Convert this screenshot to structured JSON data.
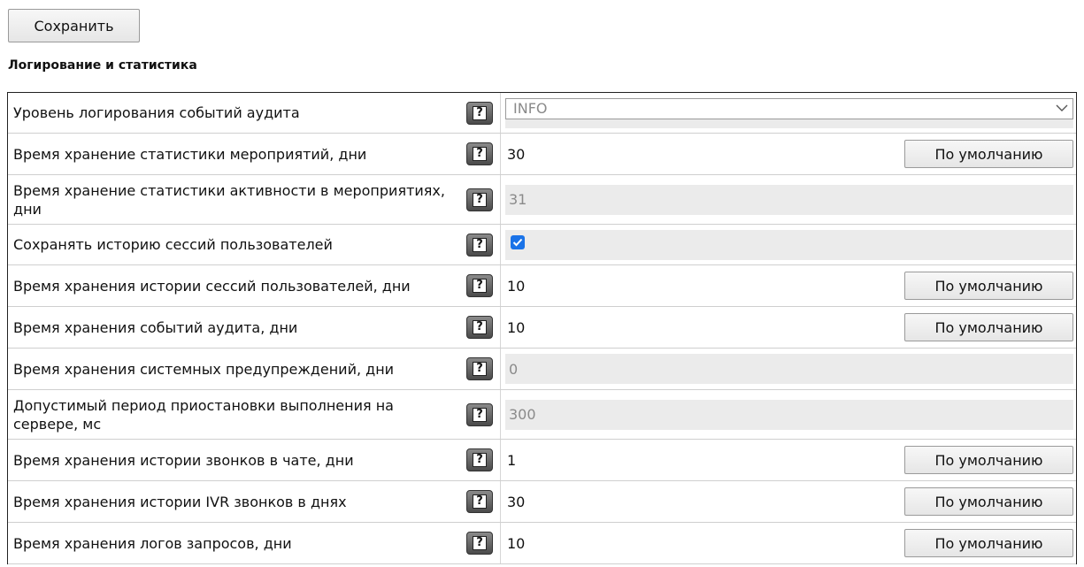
{
  "toolbar": {
    "save_label": "Сохранить"
  },
  "section": {
    "title": "Логирование и статистика"
  },
  "help": {
    "glyph": "?"
  },
  "rows": [
    {
      "label": "Уровень логирования событий аудита",
      "type": "select",
      "value": "INFO"
    },
    {
      "label": "Время хранение статистики мероприятий, дни",
      "type": "input",
      "value": "30",
      "default_label": "По умолчанию"
    },
    {
      "label": "Время хранение статистики активности в мероприятиях, дни",
      "type": "disabled",
      "value": "31"
    },
    {
      "label": "Сохранять историю сессий пользователей",
      "type": "checkbox",
      "checked": true
    },
    {
      "label": "Время хранения истории сессий пользователей, дни",
      "type": "input",
      "value": "10",
      "default_label": "По умолчанию"
    },
    {
      "label": "Время хранения событий аудита, дни",
      "type": "input",
      "value": "10",
      "default_label": "По умолчанию"
    },
    {
      "label": "Время хранения системных предупреждений, дни",
      "type": "disabled",
      "value": "0"
    },
    {
      "label": "Допустимый период приостановки выполнения на сервере, мс",
      "type": "disabled",
      "value": "300"
    },
    {
      "label": "Время хранения истории звонков в чате, дни",
      "type": "input",
      "value": "1",
      "default_label": "По умолчанию"
    },
    {
      "label": "Время хранения истории IVR звонков в днях",
      "type": "input",
      "value": "30",
      "default_label": "По умолчанию"
    },
    {
      "label": "Время хранения логов запросов, дни",
      "type": "input",
      "value": "10",
      "default_label": "По умолчанию"
    }
  ],
  "colors": {
    "checkbox": "#1a73e8",
    "disabled_bg": "#ebebeb"
  }
}
